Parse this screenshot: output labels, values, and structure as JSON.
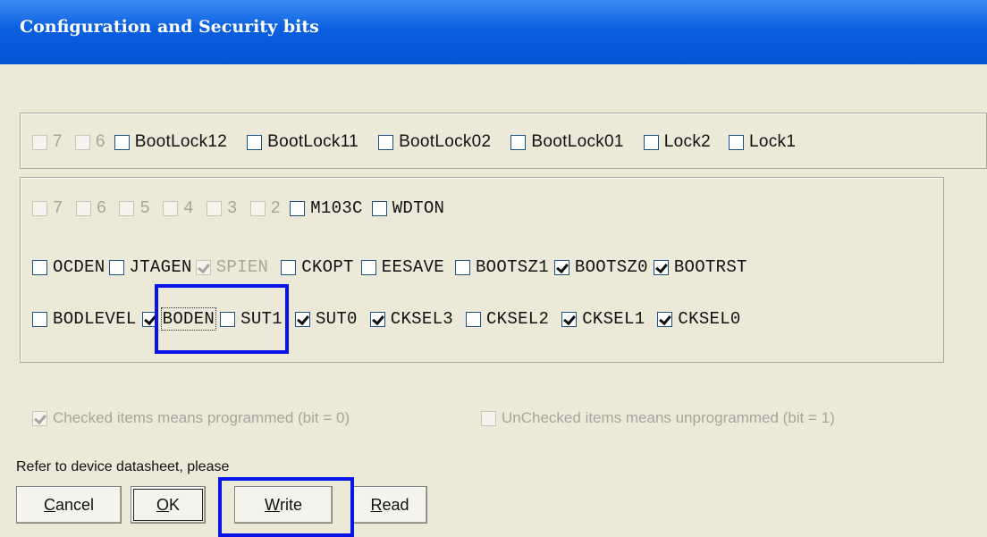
{
  "window": {
    "title": "Configuration and Security bits"
  },
  "lock_bits": [
    {
      "label": "7",
      "checked": false,
      "enabled": false
    },
    {
      "label": "6",
      "checked": false,
      "enabled": false
    },
    {
      "label": "BootLock12",
      "checked": false,
      "enabled": true
    },
    {
      "label": "BootLock11",
      "checked": false,
      "enabled": true
    },
    {
      "label": "BootLock02",
      "checked": false,
      "enabled": true
    },
    {
      "label": "BootLock01",
      "checked": false,
      "enabled": true
    },
    {
      "label": "Lock2",
      "checked": false,
      "enabled": true
    },
    {
      "label": "Lock1",
      "checked": false,
      "enabled": true
    }
  ],
  "fuse_rows": [
    [
      {
        "label": "7",
        "checked": false,
        "enabled": false
      },
      {
        "label": "6",
        "checked": false,
        "enabled": false
      },
      {
        "label": "5",
        "checked": false,
        "enabled": false
      },
      {
        "label": "4",
        "checked": false,
        "enabled": false
      },
      {
        "label": "3",
        "checked": false,
        "enabled": false
      },
      {
        "label": "2",
        "checked": false,
        "enabled": false
      },
      {
        "label": "M103C",
        "checked": false,
        "enabled": true
      },
      {
        "label": "WDTON",
        "checked": false,
        "enabled": true
      }
    ],
    [
      {
        "label": "OCDEN",
        "checked": false,
        "enabled": true
      },
      {
        "label": "JTAGEN",
        "checked": false,
        "enabled": true
      },
      {
        "label": "SPIEN",
        "checked": true,
        "enabled": false
      },
      {
        "label": "CKOPT",
        "checked": false,
        "enabled": true
      },
      {
        "label": "EESAVE",
        "checked": false,
        "enabled": true
      },
      {
        "label": "BOOTSZ1",
        "checked": false,
        "enabled": true
      },
      {
        "label": "BOOTSZ0",
        "checked": true,
        "enabled": true
      },
      {
        "label": "BOOTRST",
        "checked": true,
        "enabled": true
      }
    ],
    [
      {
        "label": "BODLEVEL",
        "checked": false,
        "enabled": true
      },
      {
        "label": "BODEN",
        "checked": true,
        "enabled": true,
        "focused": true
      },
      {
        "label": "SUT1",
        "checked": false,
        "enabled": true
      },
      {
        "label": "SUT0",
        "checked": true,
        "enabled": true
      },
      {
        "label": "CKSEL3",
        "checked": true,
        "enabled": true
      },
      {
        "label": "CKSEL2",
        "checked": false,
        "enabled": true
      },
      {
        "label": "CKSEL1",
        "checked": true,
        "enabled": true
      },
      {
        "label": "CKSEL0",
        "checked": true,
        "enabled": true
      }
    ]
  ],
  "legend": {
    "checked_text": "Checked items means programmed (bit = 0)",
    "unchecked_text": "UnChecked items means unprogrammed (bit = 1)"
  },
  "note": "Refer to device datasheet, please",
  "buttons": {
    "cancel": {
      "mnemonic": "C",
      "rest": "ancel"
    },
    "ok": {
      "mnemonic": "O",
      "rest": "K"
    },
    "write": {
      "mnemonic": "W",
      "rest": "rite"
    },
    "read": {
      "mnemonic": "R",
      "rest": "ead"
    }
  },
  "colors": {
    "highlight": "#0a14e8",
    "title_bar": "#0a5fe0",
    "dialog_bg": "#ece9d8"
  }
}
